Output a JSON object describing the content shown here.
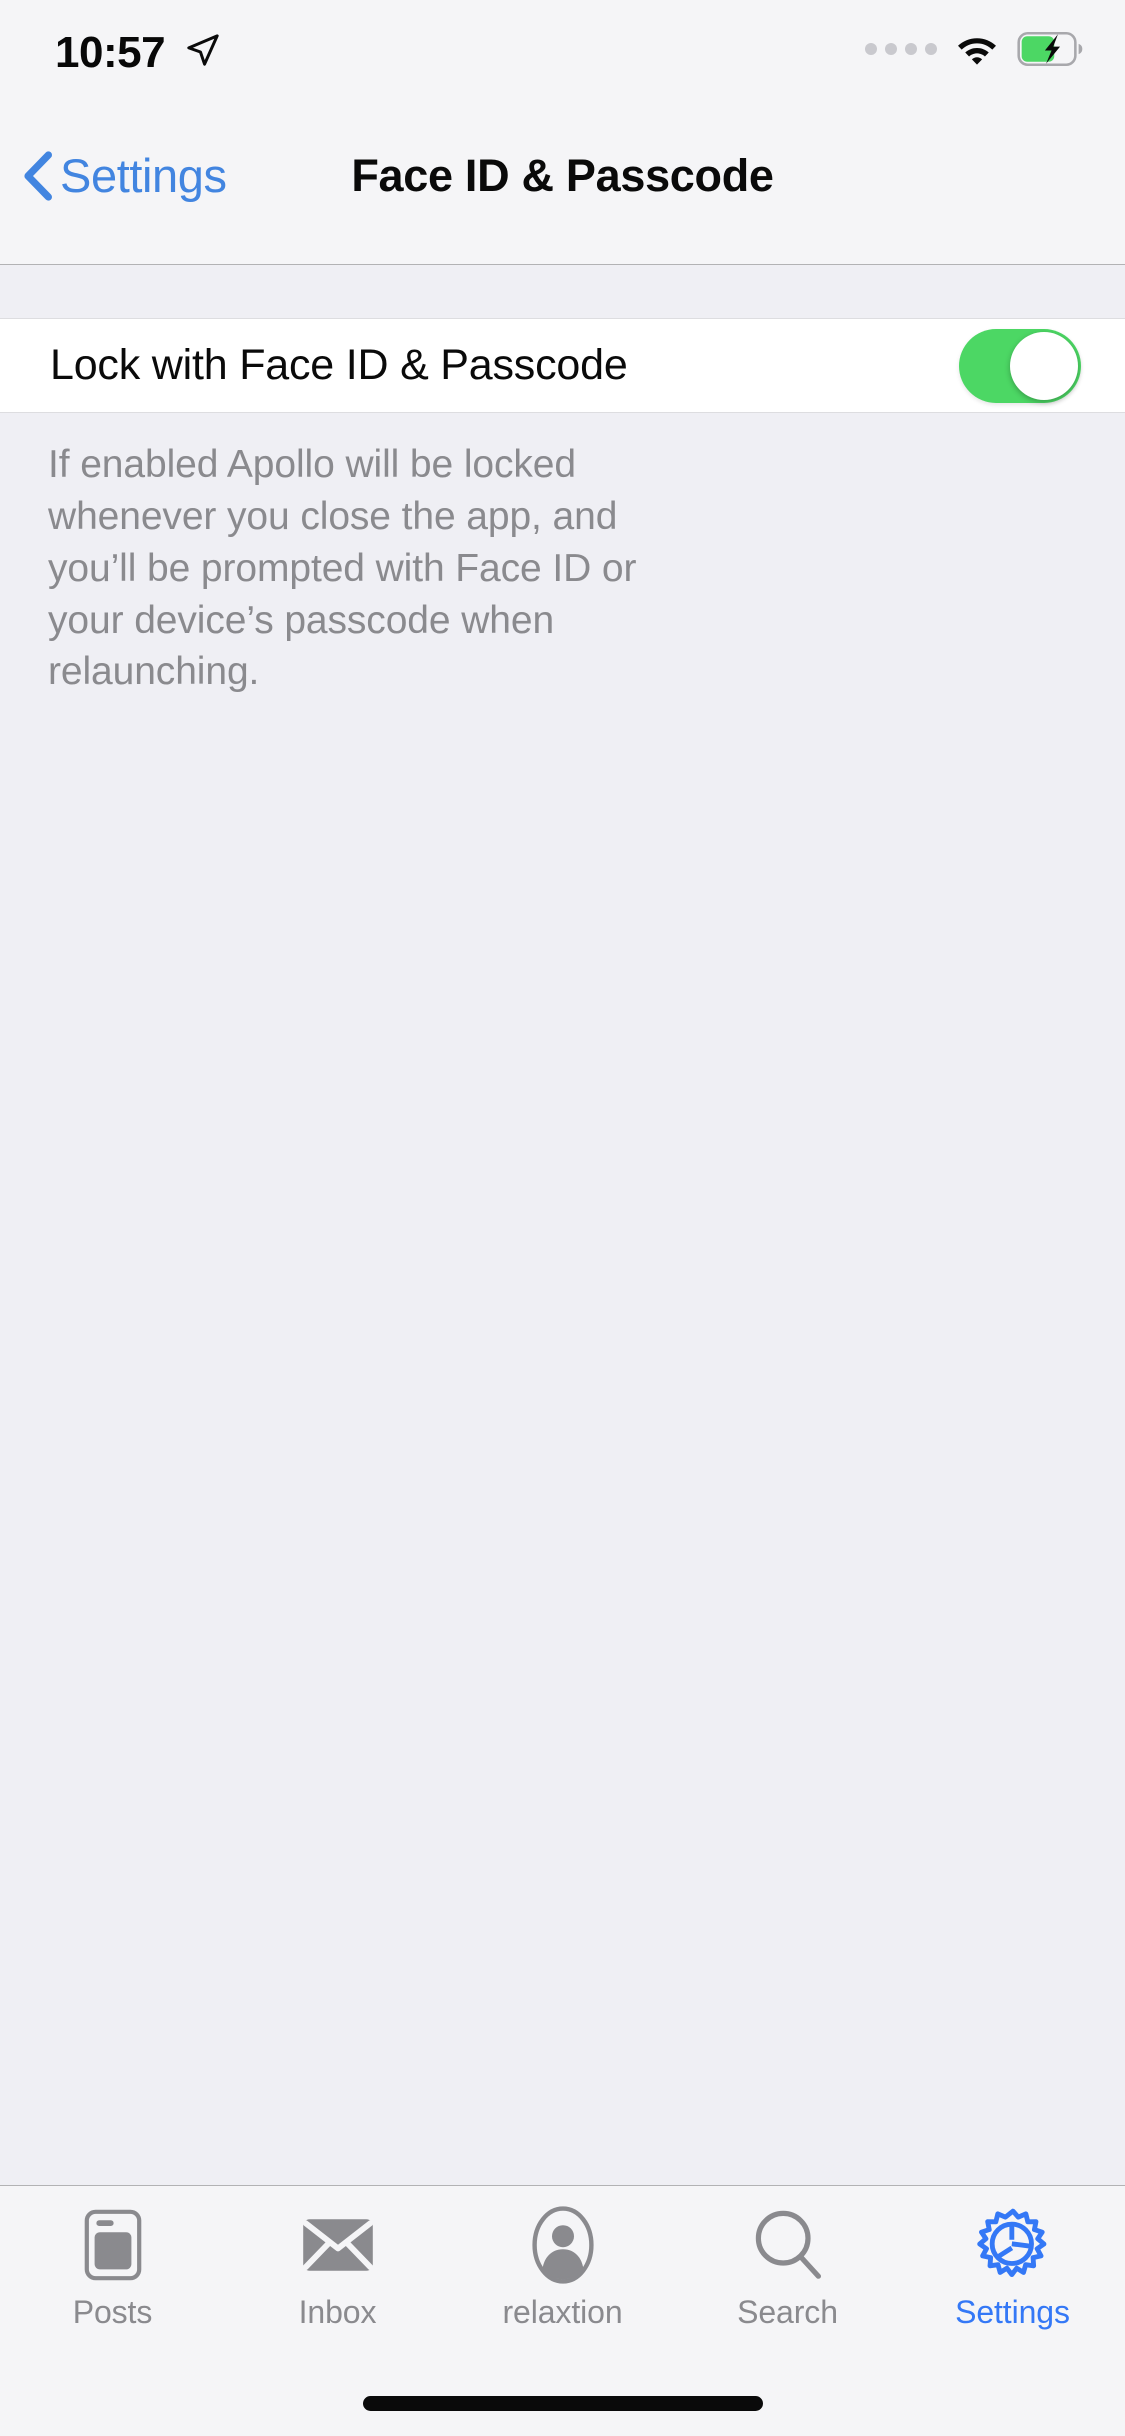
{
  "status_bar": {
    "time": "10:57",
    "location_icon": "location-arrow-icon",
    "signal_icon": "cellular-dots-icon",
    "signal_dots": 4,
    "wifi_icon": "wifi-icon",
    "battery_icon": "battery-charging-icon",
    "battery_charging": true,
    "battery_color": "#4CD764"
  },
  "nav_bar": {
    "back_label": "Settings",
    "back_icon": "chevron-left-icon",
    "title": "Face ID & Passcode",
    "accent_color": "#4285E0"
  },
  "main": {
    "rows": [
      {
        "label": "Lock with Face ID & Passcode",
        "control": "toggle-switch",
        "value": "on",
        "on_color": "#4CD764"
      }
    ],
    "footer_note": "If enabled Apollo will be locked whenever you close the app, and you’ll be prompted with Face ID or your device’s passcode when relaunching."
  },
  "tab_bar": {
    "active_color": "#3478F6",
    "inactive_color": "#8A8A8E",
    "tabs": [
      {
        "label": "Posts",
        "icon": "posts-card-icon",
        "active": false
      },
      {
        "label": "Inbox",
        "icon": "envelope-icon",
        "active": false
      },
      {
        "label": "relaxtion",
        "icon": "person-circle-icon",
        "active": false
      },
      {
        "label": "Search",
        "icon": "magnifier-icon",
        "active": false
      },
      {
        "label": "Settings",
        "icon": "gear-icon",
        "active": true
      }
    ]
  }
}
